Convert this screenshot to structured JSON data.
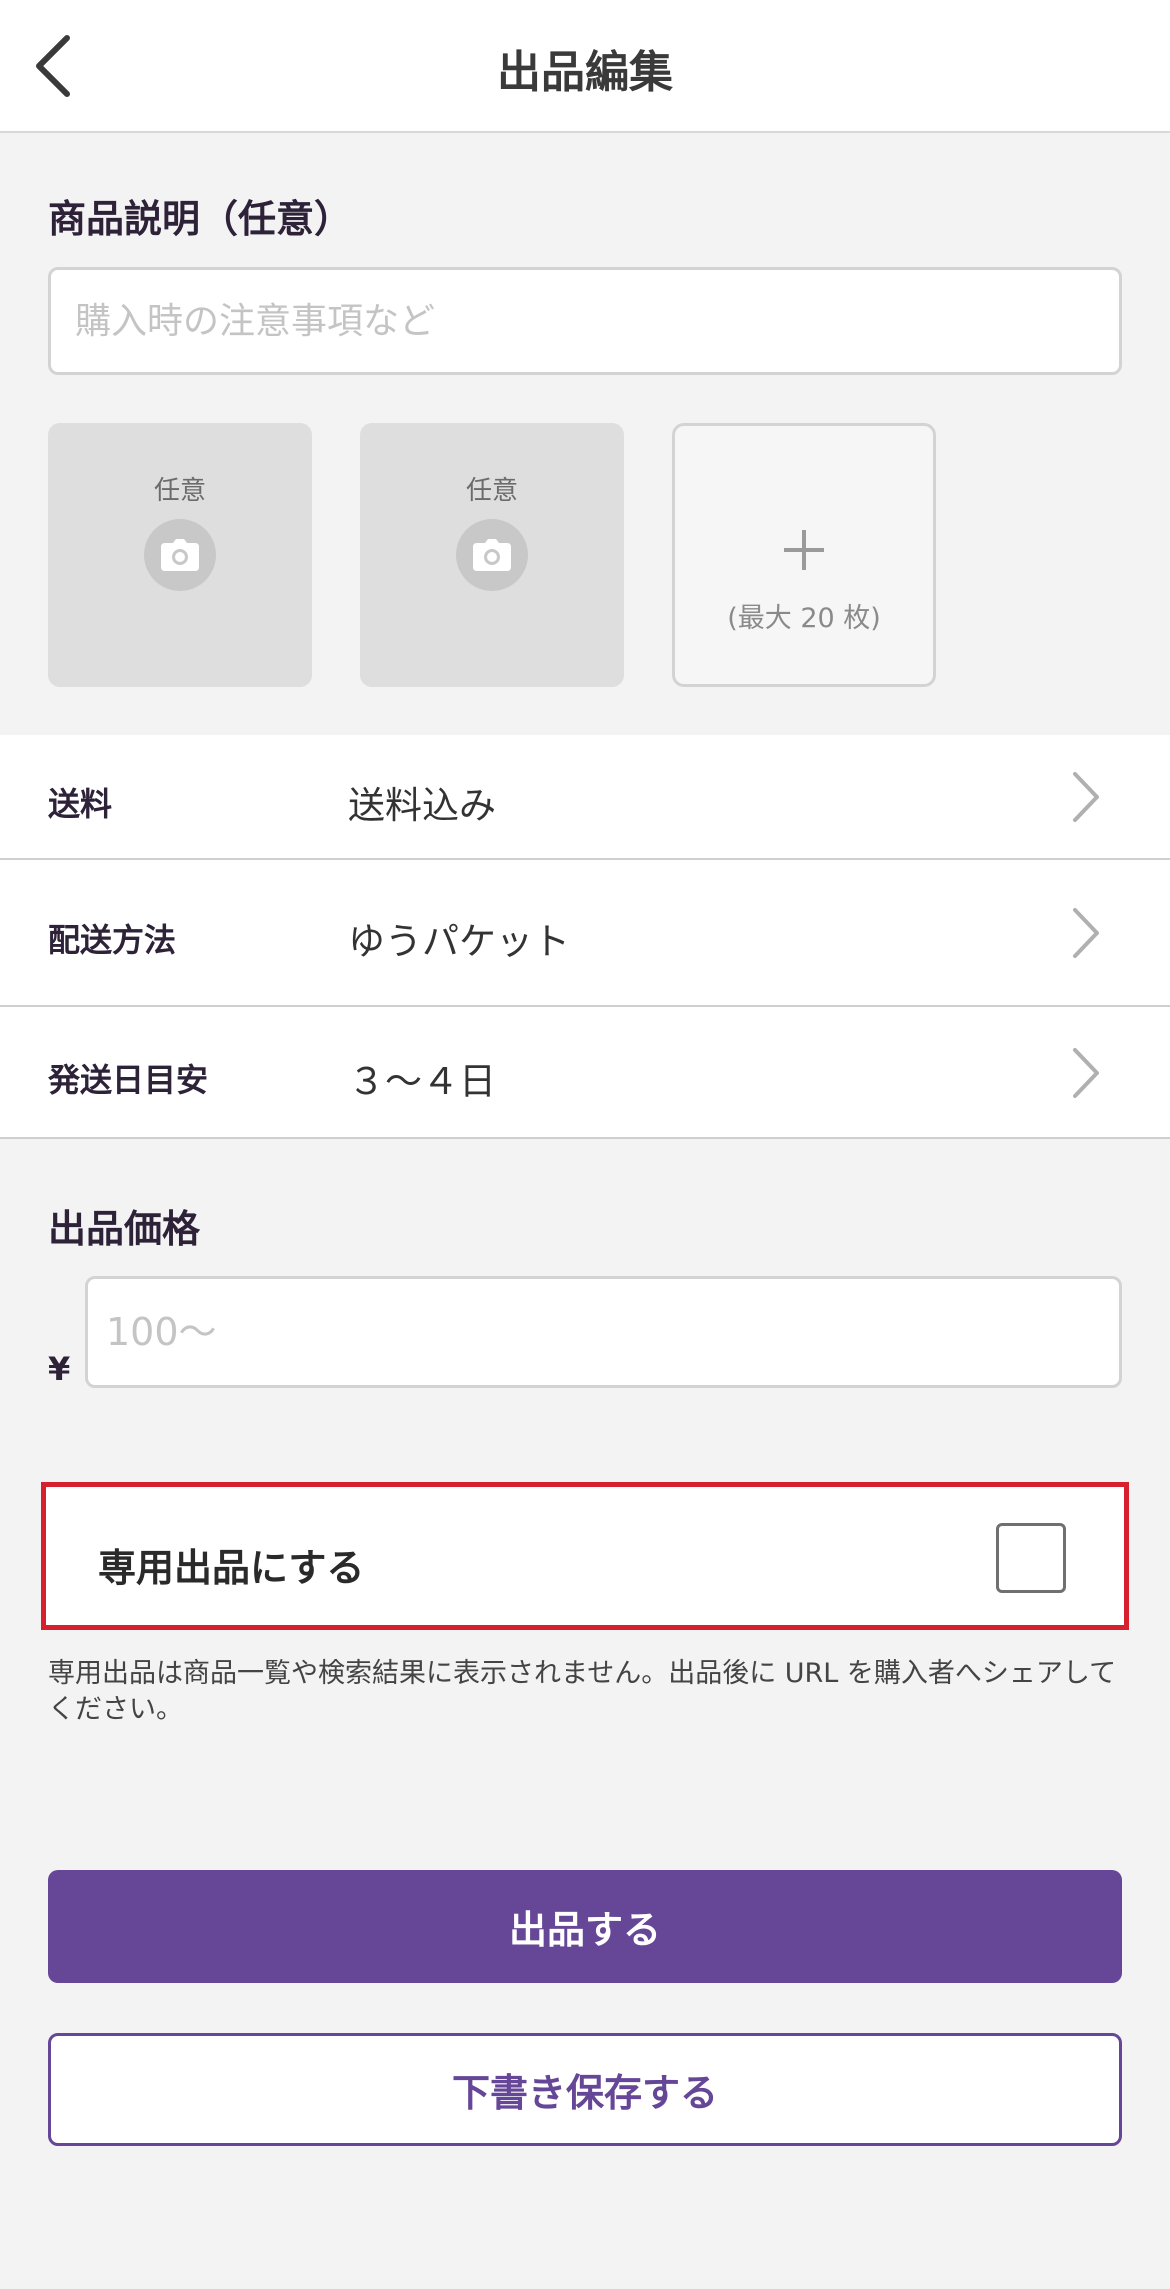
{
  "header": {
    "title": "出品編集",
    "back_icon": "chevron-left-icon"
  },
  "description": {
    "label": "商品説明（任意）",
    "placeholder": "購入時の注意事項など",
    "value": ""
  },
  "photos": {
    "slots": [
      {
        "label": "任意",
        "icon": "camera-icon"
      },
      {
        "label": "任意",
        "icon": "camera-icon"
      }
    ],
    "add": {
      "icon": "plus-icon",
      "label": "(最大 20 枚)"
    }
  },
  "settings": {
    "shipping_fee": {
      "label": "送料",
      "value": "送料込み"
    },
    "shipping_method": {
      "label": "配送方法",
      "value": "ゆうパケット"
    },
    "ship_days": {
      "label": "発送日目安",
      "value": "３～４日"
    }
  },
  "price": {
    "label": "出品価格",
    "currency": "¥",
    "placeholder": "100～",
    "value": ""
  },
  "private_listing": {
    "label": "専用出品にする",
    "checked": false,
    "note": "専用出品は商品一覧や検索結果に表示されません。出品後に URL を購入者へシェアしてください。",
    "highlight_color": "#d7202e"
  },
  "actions": {
    "submit_label": "出品する",
    "draft_label": "下書き保存する",
    "accent_color": "#654697"
  }
}
